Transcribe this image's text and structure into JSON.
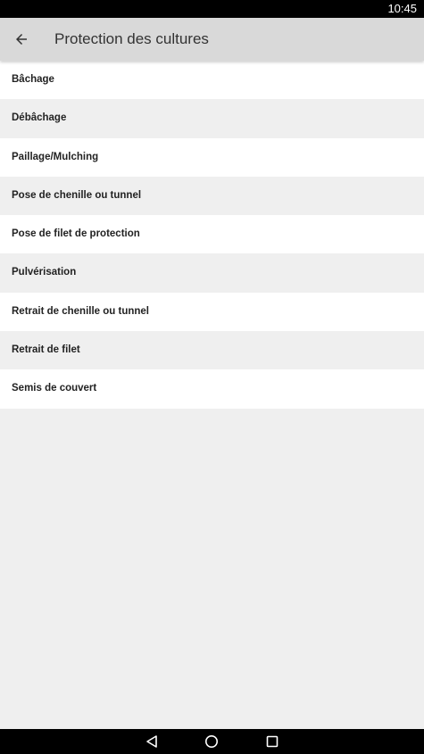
{
  "status_bar": {
    "time": "10:45"
  },
  "app_bar": {
    "back_icon": "arrow-left-icon",
    "title": "Protection des cultures"
  },
  "list": {
    "items": [
      {
        "label": "Bâchage"
      },
      {
        "label": "Débâchage"
      },
      {
        "label": "Paillage/Mulching"
      },
      {
        "label": "Pose de chenille ou tunnel"
      },
      {
        "label": "Pose de filet de protection"
      },
      {
        "label": "Pulvérisation"
      },
      {
        "label": "Retrait de chenille ou tunnel"
      },
      {
        "label": "Retrait de filet"
      },
      {
        "label": "Semis de couvert"
      }
    ]
  },
  "nav_bar": {
    "back_icon": "triangle-back-icon",
    "home_icon": "circle-home-icon",
    "recents_icon": "square-recents-icon"
  },
  "colors": {
    "status_bar": "#000000",
    "app_bar": "#d9d9d9",
    "background": "#efefef",
    "row_light": "#ffffff",
    "text": "#222222"
  }
}
